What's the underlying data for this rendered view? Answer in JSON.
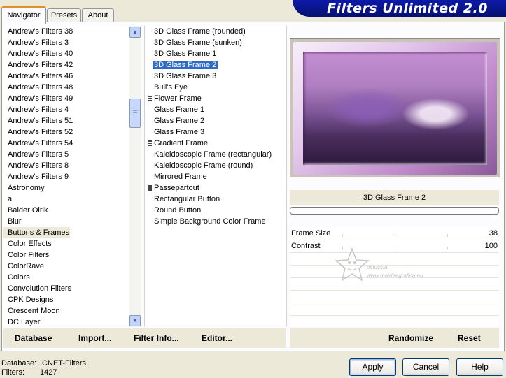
{
  "tabs": [
    {
      "label": "Navigator",
      "active": true
    },
    {
      "label": "Presets",
      "active": false
    },
    {
      "label": "About",
      "active": false
    }
  ],
  "banner": {
    "title": "Filters Unlimited 2.0"
  },
  "categories": [
    "Andrew's Filters 38",
    "Andrew's Filters 3",
    "Andrew's Filters 40",
    "Andrew's Filters 42",
    "Andrew's Filters 46",
    "Andrew's Filters 48",
    "Andrew's Filters 49",
    "Andrew's Filters 4",
    "Andrew's Filters 51",
    "Andrew's Filters 52",
    "Andrew's Filters 54",
    "Andrew's Filters 5",
    "Andrew's Filters 8",
    "Andrew's Filters 9",
    "Astronomy",
    "a",
    "Balder Olrik",
    "Blur",
    "Buttons & Frames",
    "Color Effects",
    "Color Filters",
    "ColorRave",
    "Colors",
    "Convolution Filters",
    "CPK Designs",
    "Crescent Moon",
    "DC Layer"
  ],
  "selected_category": "Buttons & Frames",
  "filters": [
    {
      "label": "3D Glass Frame (rounded)",
      "folder": false
    },
    {
      "label": "3D Glass Frame (sunken)",
      "folder": false
    },
    {
      "label": "3D Glass Frame 1",
      "folder": false
    },
    {
      "label": "3D Glass Frame 2",
      "folder": false
    },
    {
      "label": "3D Glass Frame 3",
      "folder": false
    },
    {
      "label": "Bull's Eye",
      "folder": false
    },
    {
      "label": "Flower Frame",
      "folder": true
    },
    {
      "label": "Glass Frame 1",
      "folder": false
    },
    {
      "label": "Glass Frame 2",
      "folder": false
    },
    {
      "label": "Glass Frame 3",
      "folder": false
    },
    {
      "label": "Gradient Frame",
      "folder": true
    },
    {
      "label": "Kaleidoscopic Frame (rectangular)",
      "folder": false
    },
    {
      "label": "Kaleidoscopic Frame (round)",
      "folder": false
    },
    {
      "label": "Mirrored Frame",
      "folder": false
    },
    {
      "label": "Passepartout",
      "folder": true
    },
    {
      "label": "Rectangular Button",
      "folder": false
    },
    {
      "label": "Round Button",
      "folder": false
    },
    {
      "label": "Simple Background Color Frame",
      "folder": false
    }
  ],
  "selected_filter": "3D Glass Frame 2",
  "preview": {
    "filter_name": "3D Glass Frame 2",
    "progress": 0
  },
  "params": [
    {
      "label": "Frame Size",
      "value": "38"
    },
    {
      "label": "Contrast",
      "value": "100"
    }
  ],
  "watermark": {
    "line1": "pinuccia",
    "line2": "www.maidiregrafica.eu"
  },
  "toolbar": {
    "database": {
      "pre": "",
      "u": "D",
      "post": "atabase"
    },
    "import": {
      "pre": "",
      "u": "I",
      "post": "mport..."
    },
    "filter_info": {
      "pre": "Filter ",
      "u": "I",
      "post": "nfo..."
    },
    "editor": {
      "pre": "",
      "u": "E",
      "post": "ditor..."
    },
    "randomize": {
      "pre": "",
      "u": "R",
      "post": "andomize"
    },
    "reset": {
      "pre": "",
      "u": "R",
      "post": "eset"
    }
  },
  "status": {
    "database_label": "Database:",
    "database_value": "ICNET-Filters",
    "filters_label": "Filters:",
    "filters_value": "1427"
  },
  "buttons": {
    "apply": "Apply",
    "cancel": "Cancel",
    "help": "Help"
  },
  "colors": {
    "selection": "#316ac5",
    "banner": "#0c1aa8",
    "window_bg": "#ece9d8",
    "progress": "#3d95ff"
  },
  "icons": {
    "scroll_up": "chevron-up-icon",
    "scroll_down": "chevron-down-icon",
    "folder": "submenu-icon"
  }
}
